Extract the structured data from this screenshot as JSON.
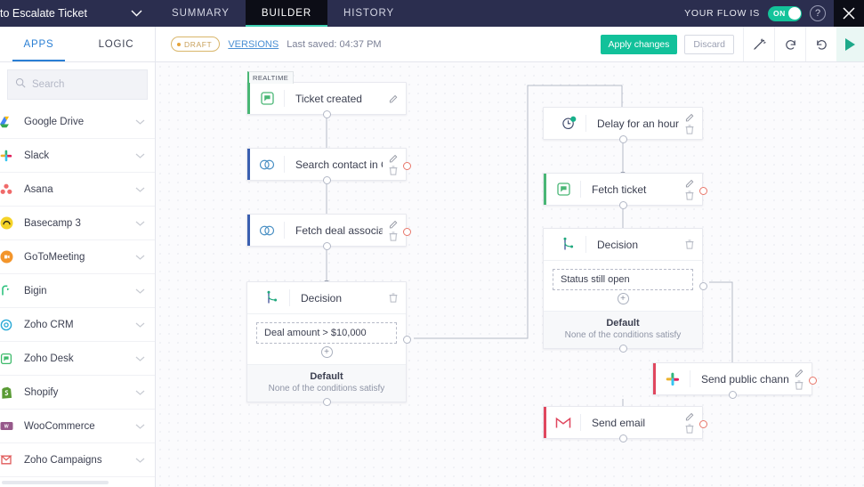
{
  "topbar": {
    "flow_name": "to Escalate Ticket",
    "chevron_icon": "chevron-down-icon",
    "tabs": [
      {
        "label": "SUMMARY",
        "active": false
      },
      {
        "label": "BUILDER",
        "active": true
      },
      {
        "label": "HISTORY",
        "active": false
      }
    ],
    "flow_state_label": "YOUR FLOW IS",
    "toggle_label": "ON",
    "help_label": "?",
    "close_icon": "close-icon"
  },
  "secondbar": {
    "left_tabs": [
      {
        "label": "APPS",
        "active": true
      },
      {
        "label": "LOGIC",
        "active": false
      }
    ],
    "draft_label": "DRAFT",
    "versions_label": "VERSIONS",
    "last_saved": "Last saved: 04:37 PM",
    "apply_label": "Apply changes",
    "discard_label": "Discard",
    "icons": [
      "magic-wand-icon",
      "undo-icon",
      "redo-icon"
    ],
    "play_icon": "play-icon"
  },
  "sidebar": {
    "search_placeholder": "Search",
    "search_value": "",
    "search_icon": "search-icon",
    "apps": [
      {
        "label": "Google Drive",
        "icon": "google-drive-icon",
        "color": "#f6c744"
      },
      {
        "label": "Slack",
        "icon": "slack-icon",
        "color": "#4cb050"
      },
      {
        "label": "Asana",
        "icon": "asana-icon",
        "color": "#f06a6a"
      },
      {
        "label": "Basecamp 3",
        "icon": "basecamp-icon",
        "color": "#f5d328"
      },
      {
        "label": "GoToMeeting",
        "icon": "gotomeeting-icon",
        "color": "#f3952b"
      },
      {
        "label": "Bigin",
        "icon": "bigin-icon",
        "color": "#2ec27e"
      },
      {
        "label": "Zoho CRM",
        "icon": "zoho-crm-icon",
        "color": "#2aa9d6"
      },
      {
        "label": "Zoho Desk",
        "icon": "zoho-desk-icon",
        "color": "#3dba6a"
      },
      {
        "label": "Shopify",
        "icon": "shopify-icon",
        "color": "#5a9b35"
      },
      {
        "label": "WooCommerce",
        "icon": "woocommerce-icon",
        "color": "#96588a"
      },
      {
        "label": "Zoho Campaigns",
        "icon": "zoho-campaigns-icon",
        "color": "#e05a5a"
      }
    ]
  },
  "canvas": {
    "nodes": [
      {
        "id": "ticket-created",
        "title": "Ticket created",
        "badge": "REALTIME",
        "accent": "#49b675",
        "icon": "zoho-desk-icon",
        "actions": [
          "edit-icon"
        ]
      },
      {
        "id": "search-contact-crm",
        "title": "Search contact in CRM",
        "accent": "#3a5fb0",
        "icon": "zoho-crm-icon",
        "actions": [
          "edit-icon",
          "delete-icon"
        ]
      },
      {
        "id": "fetch-deal-associated",
        "title": "Fetch deal associated ...",
        "accent": "#3a5fb0",
        "icon": "zoho-crm-icon",
        "actions": [
          "edit-icon",
          "delete-icon"
        ]
      },
      {
        "id": "decision-left",
        "title": "Decision",
        "accent": "",
        "icon": "decision-icon",
        "actions": [
          "delete-icon"
        ],
        "condition": "Deal amount > $10,000",
        "default_title": "Default",
        "default_sub": "None of the conditions satisfy"
      },
      {
        "id": "delay-for-an-hour",
        "title": "Delay for an hour",
        "accent": "",
        "icon": "clock-icon",
        "actions": [
          "edit-icon",
          "delete-icon"
        ]
      },
      {
        "id": "fetch-ticket",
        "title": "Fetch ticket",
        "accent": "#49b675",
        "icon": "zoho-desk-icon",
        "actions": [
          "edit-icon",
          "delete-icon"
        ]
      },
      {
        "id": "decision-right",
        "title": "Decision",
        "accent": "",
        "icon": "decision-icon",
        "actions": [
          "delete-icon"
        ],
        "condition": "Status still open",
        "default_title": "Default",
        "default_sub": "None of the conditions satisfy"
      },
      {
        "id": "send-public-channel-message",
        "title": "Send public channel m...",
        "accent": "#e0475e",
        "icon": "slack-icon",
        "actions": [
          "edit-icon",
          "delete-icon"
        ]
      },
      {
        "id": "send-email",
        "title": "Send email",
        "accent": "#e0475e",
        "icon": "gmail-icon",
        "actions": [
          "edit-icon",
          "delete-icon"
        ]
      }
    ]
  },
  "colors": {
    "topbar_bg": "#2b2e4f",
    "accent_teal": "#12c19a",
    "accent_blue": "#2a7fd4",
    "canvas_bg": "#fbfbfd"
  }
}
